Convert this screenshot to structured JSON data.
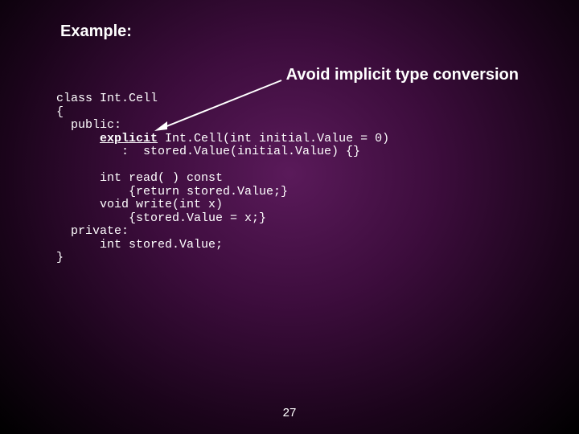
{
  "heading": "Example:",
  "callout": "Avoid implicit type conversion",
  "code": {
    "line1": "class Int.Cell",
    "line2": "{",
    "line3": "  public:",
    "keyword_explicit": "explicit",
    "line4_rest": " Int.Cell(int initial.Value = 0)",
    "line5": "         :  stored.Value(initial.Value) {}",
    "line6": "      int read( ) const",
    "line7": "          {return stored.Value;}",
    "line8": "      void write(int x)",
    "line9": "          {stored.Value = x;}",
    "line10": "  private:",
    "line11": "      int stored.Value;",
    "line12": "}"
  },
  "page_number": "27"
}
